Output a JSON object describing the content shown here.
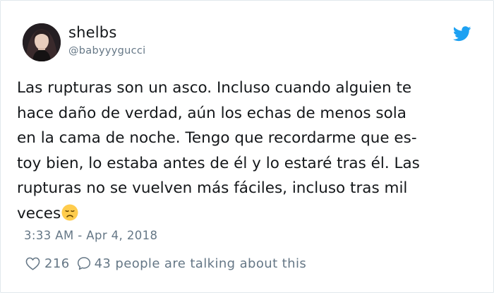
{
  "user": {
    "display_name": "shelbs",
    "handle": "@babyyygucci"
  },
  "tweet": {
    "lines": [
      "Las rupturas son un asco. Incluso cuando alguien te",
      "hace daño de verdad, aún los echas de menos sola",
      "en la cama de noche. Tengo que recordarme que es-",
      "toy bien, lo estaba antes de él y lo estaré tras él. Las",
      "rupturas no se vuelven más fáciles, incluso tras mil",
      "veces"
    ],
    "emoji": "disappointed-face-emoji",
    "timestamp": "3:33 AM - Apr 4, 2018"
  },
  "engagement": {
    "likes": "216",
    "talking": "43 people are talking about this"
  },
  "icons": {
    "brand": "twitter-bird-icon",
    "like": "heart-icon",
    "reply": "speech-bubble-icon"
  },
  "colors": {
    "brand": "#1da1f2",
    "text": "#14171a",
    "secondary": "#657786",
    "border": "#e1e8ed",
    "emoji": "#ffcc4d"
  }
}
